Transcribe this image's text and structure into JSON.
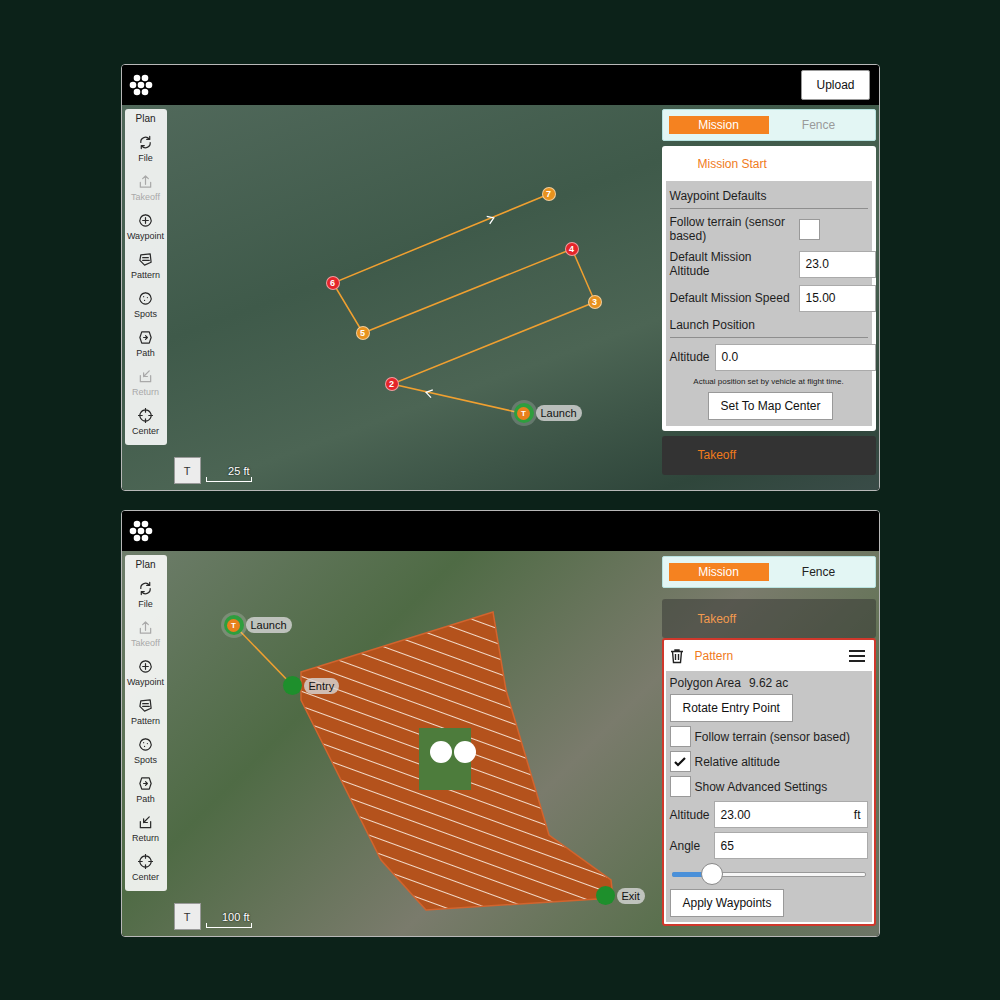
{
  "screens": [
    {
      "kind": "mission",
      "upload": "Upload",
      "tool_title": "Plan",
      "tools": [
        {
          "label": "File",
          "disabled": false
        },
        {
          "label": "Takeoff",
          "disabled": true
        },
        {
          "label": "Waypoint",
          "disabled": false
        },
        {
          "label": "Pattern",
          "disabled": false
        },
        {
          "label": "Spots",
          "disabled": false
        },
        {
          "label": "Path",
          "disabled": false
        },
        {
          "label": "Return",
          "disabled": true
        },
        {
          "label": "Center",
          "disabled": false
        }
      ],
      "map": {
        "toggle": "T",
        "scale": "25 ft",
        "launch": {
          "badge": "T",
          "label": "Launch"
        },
        "waypoints": [
          {
            "label": "2",
            "color": "#e5252a"
          },
          {
            "label": "3",
            "color": "#e8921e"
          },
          {
            "label": "4",
            "color": "#e5252a"
          },
          {
            "label": "5",
            "color": "#e8921e"
          },
          {
            "label": "6",
            "color": "#e5252a"
          },
          {
            "label": "7",
            "color": "#e8921e"
          }
        ]
      },
      "tabs": [
        {
          "label": "Mission",
          "selected": true,
          "disabled": false
        },
        {
          "label": "Fence",
          "selected": false,
          "disabled": true
        }
      ],
      "panel": {
        "title": "Mission Start",
        "section": "Waypoint Defaults",
        "follow_terrain": {
          "label": "Follow terrain (sensor based)",
          "checked": false
        },
        "fields": [
          {
            "label": "Default Mission Altitude",
            "value": "23.0"
          },
          {
            "label": "Default Mission Speed",
            "value": "15.00"
          }
        ],
        "launch_section": "Launch Position",
        "launch_altitude": {
          "label": "Altitude",
          "value": "0.0"
        },
        "note": "Actual position set by vehicle at flight time.",
        "button": "Set To Map Center"
      },
      "next_item": "Takeoff"
    },
    {
      "kind": "pattern",
      "tool_title": "Plan",
      "tools": [
        {
          "label": "File",
          "disabled": false
        },
        {
          "label": "Takeoff",
          "disabled": true
        },
        {
          "label": "Waypoint",
          "disabled": false
        },
        {
          "label": "Pattern",
          "disabled": false
        },
        {
          "label": "Spots",
          "disabled": false
        },
        {
          "label": "Path",
          "disabled": false
        },
        {
          "label": "Return",
          "disabled": false
        },
        {
          "label": "Center",
          "disabled": false
        }
      ],
      "map": {
        "toggle": "T",
        "scale": "100 ft",
        "launch": {
          "badge": "T",
          "label": "Launch"
        },
        "entry": "Entry",
        "exit": "Exit"
      },
      "tabs": [
        {
          "label": "Mission",
          "selected": true,
          "disabled": false
        },
        {
          "label": "Fence",
          "selected": false,
          "disabled": false
        }
      ],
      "prev_item": "Takeoff",
      "panel": {
        "title": "Pattern",
        "area_label": "Polygon Area",
        "area_value": "9.62 ac",
        "rotate_button": "Rotate Entry Point",
        "options": [
          {
            "label": "Follow terrain (sensor based)",
            "checked": false
          },
          {
            "label": "Relative altitude",
            "checked": true
          },
          {
            "label": "Show Advanced Settings",
            "checked": false
          }
        ],
        "altitude": {
          "label": "Altitude",
          "value": "23.00",
          "unit": "ft"
        },
        "angle": {
          "label": "Angle",
          "value": "65"
        },
        "slider": {
          "level": 0.21
        },
        "apply_button": "Apply Waypoints"
      }
    }
  ]
}
